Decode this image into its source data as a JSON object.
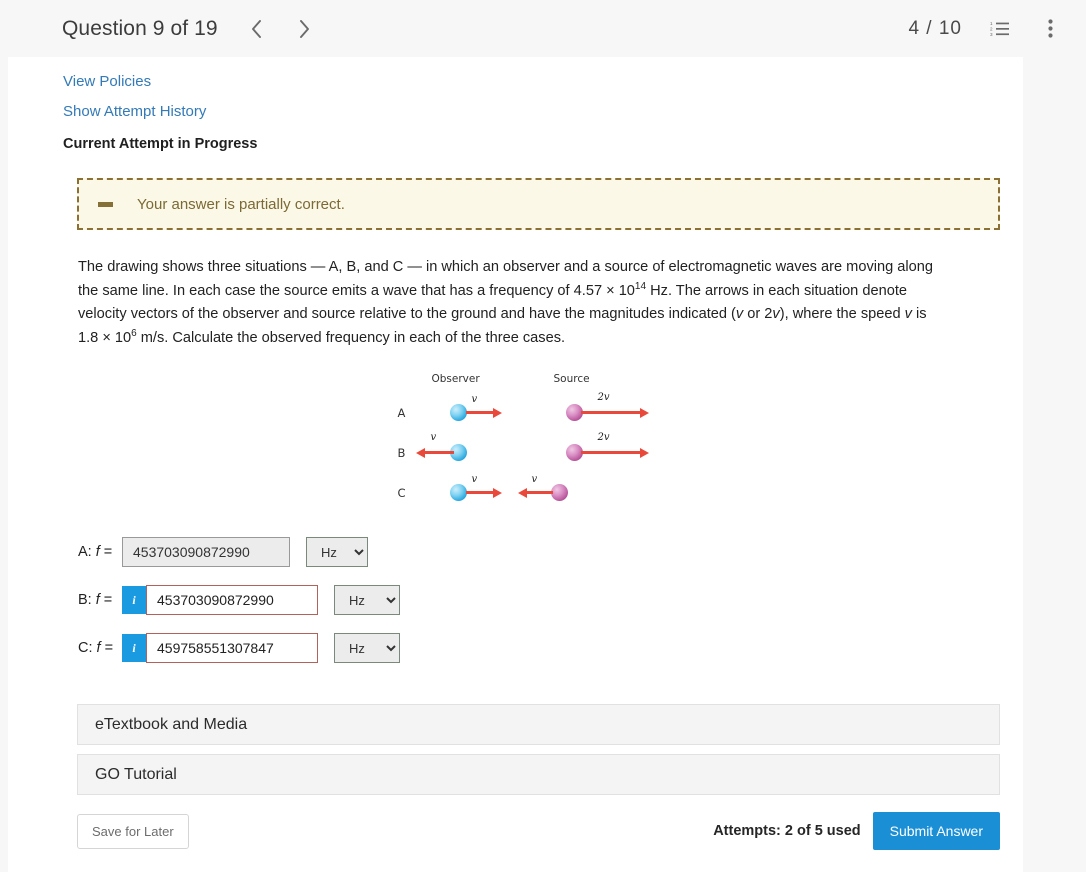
{
  "header": {
    "question_title": "Question 9 of 19",
    "prev_icon": "chevron-left-icon",
    "next_icon": "chevron-right-icon",
    "page_count": "4 / 10",
    "list_icon": "numbered-list-icon",
    "more_icon": "kebab-menu-icon"
  },
  "links": {
    "view_policies": "View Policies",
    "show_attempt_history": "Show Attempt History"
  },
  "attempt_heading": "Current Attempt in Progress",
  "alert": {
    "icon": "minus-dash-icon",
    "message": "Your answer is partially correct.",
    "bg_color": "#fbf8e8",
    "border_color": "#8a7033",
    "text_color": "#7b6a33"
  },
  "question": {
    "p1_a": "The drawing shows three situations — A, B, and C — in which an observer and a source of electromagnetic waves are moving along the same line. In each case the source emits a wave that has a frequency of 4.57 × 10",
    "p1_sup": "14",
    "p1_b": " Hz. The arrows in each situation denote velocity vectors of the observer and source relative to the ground and have the magnitudes indicated (",
    "p1_v1": "v",
    "p1_c": " or 2",
    "p1_v2": "v",
    "p1_d": "), where the speed ",
    "p1_v3": "v",
    "p1_e": " is 1.8 × 10",
    "p1_sup2": "6",
    "p1_f": " m/s. Calculate the observed frequency in each of the three cases."
  },
  "figure": {
    "observer_header": "Observer",
    "source_header": "Source",
    "rows": [
      {
        "label": "A",
        "observer_speed": "v",
        "observer_dir": "right",
        "source_speed": "2v",
        "source_dir": "right"
      },
      {
        "label": "B",
        "observer_speed": "v",
        "observer_dir": "left",
        "source_speed": "2v",
        "source_dir": "right"
      },
      {
        "label": "C",
        "observer_speed": "v",
        "observer_dir": "right",
        "source_speed": "v",
        "source_dir": "left"
      }
    ],
    "observer_color": "#2ba8e0",
    "source_color": "#b8559b",
    "arrow_color": "#e8493a"
  },
  "answers": {
    "rows": [
      {
        "label_prefix": "A: ",
        "label_f": "f",
        "label_eq": " =",
        "value": "453703090872990",
        "unit": "Hz",
        "has_info": false,
        "readonly": true
      },
      {
        "label_prefix": "B: ",
        "label_f": "f",
        "label_eq": " =",
        "value": "453703090872990",
        "unit": "Hz",
        "has_info": true,
        "info_label": "i",
        "readonly": false
      },
      {
        "label_prefix": "C: ",
        "label_f": "f",
        "label_eq": " =",
        "value": "459758551307847",
        "unit": "Hz",
        "has_info": true,
        "info_label": "i",
        "readonly": false
      }
    ],
    "unit_options": [
      "Hz"
    ]
  },
  "panels": {
    "etextbook": "eTextbook and Media",
    "go_tutorial": "GO Tutorial"
  },
  "footer": {
    "save_label": "Save for Later",
    "attempts": "Attempts: 2 of 5 used",
    "submit_label": "Submit Answer",
    "submit_color": "#1a8fd6"
  }
}
